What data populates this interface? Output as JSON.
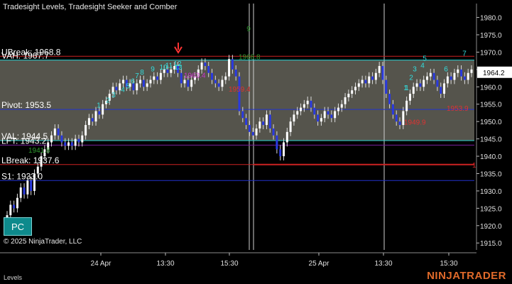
{
  "header": {
    "title": "Tradesight Levels, Tradesight Seeker and Comber"
  },
  "footer": {
    "copyright": "© 2025 NinjaTrader, LLC",
    "tab_label": "Levels",
    "brand": "NINJATRADER"
  },
  "button": {
    "pc_label": "PC"
  },
  "colors": {
    "zone_fill": "#5a5850",
    "vah": "#2ad6d6",
    "val": "#2ad6d6",
    "pivot": "#2233cc",
    "lbreak": "#cc2222",
    "lft": "#7a1fa0",
    "s1": "#2233cc",
    "ubreak": "#cc2222",
    "candle": "#ffffff",
    "candle_down": "#2a3adf",
    "marker_green": "#2e9a2e",
    "marker_cyan": "#33dddd",
    "marker_red": "#dd3333"
  },
  "chart_data": {
    "type": "candlestick",
    "y_axis": {
      "ylim": [
        1913,
        1984
      ],
      "ticks": [
        1915.0,
        1920.0,
        1925.0,
        1930.0,
        1935.0,
        1940.0,
        1945.0,
        1950.0,
        1955.0,
        1960.0,
        1965.0,
        1970.0,
        1975.0,
        1980.0
      ]
    },
    "x_axis": {
      "tick_labels": [
        "24 Apr",
        "13:30",
        "15:30",
        "25 Apr",
        "13:30",
        "15:30"
      ]
    },
    "current_price": 1964.2,
    "levels": [
      {
        "label": "UBreak: 1968.8",
        "value": 1968.8,
        "color": "#cc2222"
      },
      {
        "label": "VAH: 1967.7",
        "value": 1967.7,
        "color": "#2ad6d6"
      },
      {
        "label": "Pivot: 1953.5",
        "value": 1953.5,
        "color": "#2233cc"
      },
      {
        "label": "VAL: 1944.5",
        "value": 1944.5,
        "color": "#2ad6d6"
      },
      {
        "label": "LFT: 1943.2",
        "value": 1943.2,
        "color": "#7a1fa0"
      },
      {
        "label": "LBreak: 1937.6",
        "value": 1937.6,
        "color": "#cc2222"
      },
      {
        "label": "S1: 1933.0",
        "value": 1933.0,
        "color": "#2233cc"
      }
    ],
    "price_labels": [
      {
        "text": "1963.4",
        "value": 1963.4,
        "color": "#cc33cc"
      },
      {
        "text": "1959.4",
        "value": 1959.4,
        "color": "#dd3333"
      },
      {
        "text": "1949.9",
        "value": 1949.9,
        "color": "#dd3333"
      },
      {
        "text": "1953.9",
        "value": 1953.9,
        "color": "#dd3333"
      },
      {
        "text": "1941.8",
        "value": 1941.8,
        "color": "#2e9a2e"
      },
      {
        "text": "1968.8",
        "value": 1968.8,
        "color": "#2e9a2e"
      }
    ],
    "seeker_counts": [
      "1",
      "2",
      "3",
      "4",
      "5",
      "6",
      "7",
      "8",
      "9",
      "10",
      "11",
      "12",
      "13",
      "9",
      "1",
      "2",
      "3",
      "4",
      "5",
      "6",
      "7",
      "1"
    ],
    "closes": [
      1923,
      1926,
      1925,
      1928,
      1931,
      1929,
      1933,
      1930,
      1935,
      1937,
      1940,
      1942,
      1944,
      1946,
      1948,
      1946,
      1944,
      1943,
      1944,
      1943,
      1945,
      1944,
      1946,
      1949,
      1951,
      1950,
      1953,
      1952,
      1955,
      1956,
      1958,
      1960,
      1959,
      1961,
      1962,
      1960,
      1961,
      1959,
      1961,
      1962,
      1960,
      1961,
      1962,
      1963,
      1962,
      1964,
      1965,
      1964,
      1965,
      1966,
      1964,
      1961,
      1962,
      1960,
      1962,
      1963,
      1965,
      1967,
      1966,
      1964,
      1962,
      1961,
      1960,
      1962,
      1963,
      1968,
      1965,
      1963,
      1953,
      1951,
      1949,
      1947,
      1946,
      1948,
      1950,
      1949,
      1952,
      1948,
      1946,
      1942,
      1940,
      1944,
      1947,
      1950,
      1952,
      1953,
      1954,
      1955,
      1956,
      1954,
      1952,
      1950,
      1951,
      1953,
      1952,
      1951,
      1953,
      1954,
      1955,
      1957,
      1958,
      1959,
      1960,
      1961,
      1962,
      1961,
      1963,
      1962,
      1964,
      1966,
      1962,
      1958,
      1955,
      1952,
      1950,
      1949,
      1953,
      1956,
      1958,
      1960,
      1961,
      1960,
      1962,
      1963,
      1964,
      1962,
      1960,
      1958,
      1961,
      1963,
      1962,
      1964,
      1965,
      1963,
      1962,
      1964,
      1965
    ]
  }
}
